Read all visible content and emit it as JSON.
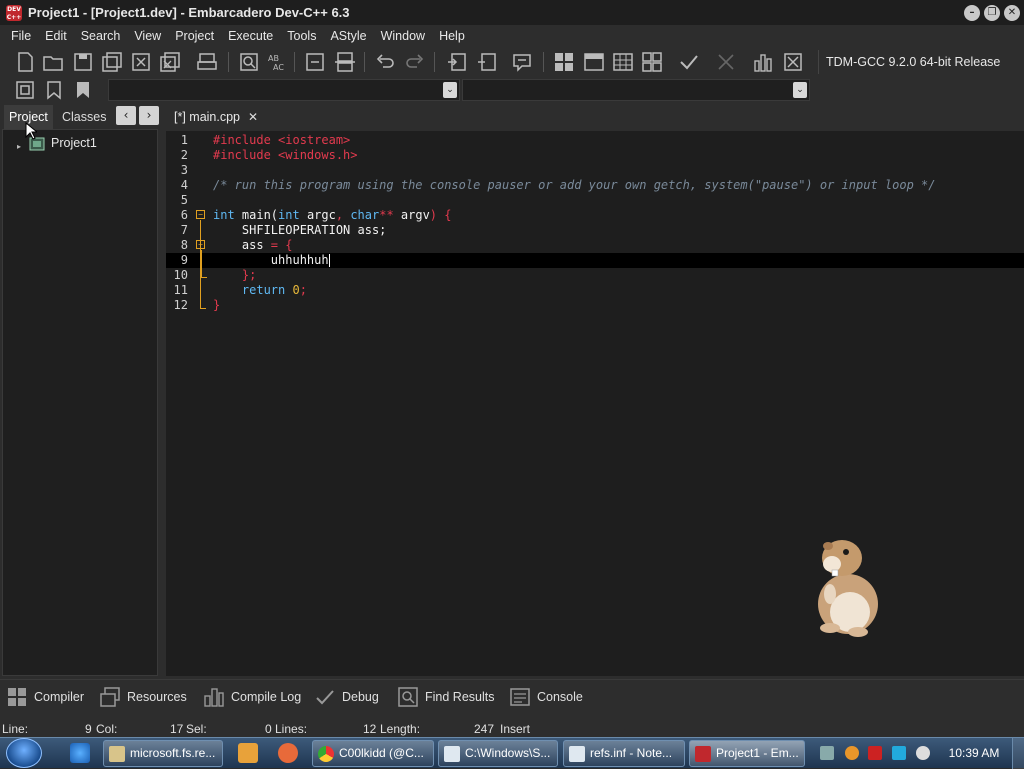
{
  "window": {
    "title": "Project1 - [Project1.dev] - Embarcadero Dev-C++ 6.3",
    "logo_text": "DEV C++",
    "controls": [
      "minimize",
      "restore",
      "close"
    ]
  },
  "menu": [
    "File",
    "Edit",
    "Search",
    "View",
    "Project",
    "Execute",
    "Tools",
    "AStyle",
    "Window",
    "Help"
  ],
  "toolbar": {
    "compiler": "TDM-GCC 9.2.0 64-bit Release",
    "buttons": [
      "new-icon",
      "open-icon",
      "save-icon",
      "save-all-icon",
      "close-icon",
      "close-all-icon",
      "print-icon",
      "find-icon",
      "replace-icon",
      "goto-icon",
      "layout-icon",
      "undo-icon",
      "redo-icon",
      "indent-icon",
      "unindent-icon",
      "comment-icon",
      "compile-icon",
      "run-icon",
      "compile-run-icon",
      "rebuild-icon",
      "syntax-check-icon",
      "stop-icon",
      "chart-icon",
      "debug-stop-icon"
    ]
  },
  "left_panel": {
    "tabs": [
      "Project",
      "Classes"
    ],
    "active_tab": "Project",
    "tree": [
      {
        "label": "Project1"
      }
    ]
  },
  "editor": {
    "tab_label": "[*] main.cpp",
    "current_line": 9,
    "lines": [
      {
        "n": "1"
      },
      {
        "n": "2"
      },
      {
        "n": "3"
      },
      {
        "n": "4"
      },
      {
        "n": "5"
      },
      {
        "n": "6"
      },
      {
        "n": "7"
      },
      {
        "n": "8"
      },
      {
        "n": "9"
      },
      {
        "n": "10"
      },
      {
        "n": "11"
      },
      {
        "n": "12"
      }
    ],
    "code": {
      "l1": "#include <iostream>",
      "l2": "#include <windows.h>",
      "l4": "/* run this program using the console pauser or add your own getch, system(\"pause\") or input loop */",
      "l6_kw": "int",
      "l6_fn": " main(",
      "l6_kw2": "int",
      "l6_a": " argc",
      "l6_c": ",",
      "l6_kw3": " char",
      "l6_st": "**",
      "l6_b": " argv",
      "l6_end": ") {",
      "l7": "    SHFILEOPERATION ass;",
      "l8_a": "    ass ",
      "l8_b": "= {",
      "l9": "        uhhuhhuh",
      "l10": "    };",
      "l11_kw": "    return ",
      "l11_num": "0",
      "l11_end": ";",
      "l12": "}"
    }
  },
  "bottom_tabs": [
    {
      "label": "Compiler",
      "icon": "compiler-grid-icon"
    },
    {
      "label": "Resources",
      "icon": "resources-icon"
    },
    {
      "label": "Compile Log",
      "icon": "compile-log-chart-icon"
    },
    {
      "label": "Debug",
      "icon": "debug-check-icon"
    },
    {
      "label": "Find Results",
      "icon": "find-results-icon"
    },
    {
      "label": "Console",
      "icon": "console-icon"
    }
  ],
  "status": {
    "line_label": "Line:",
    "line_val": "9",
    "col_label": "Col:",
    "col_val": "17",
    "sel_label": "Sel:",
    "sel_val": "0",
    "lines_label": "Lines:",
    "lines_val": "12",
    "length_label": "Length:",
    "length_val": "247",
    "mode": "Insert"
  },
  "taskbar": {
    "tasks": [
      {
        "label": "microsoft.fs.re...",
        "icon": "explorer-icon"
      },
      {
        "label": "C00lkidd (@C...",
        "icon": "chrome-icon"
      },
      {
        "label": "C:\\Windows\\S...",
        "icon": "notepad-icon"
      },
      {
        "label": "refs.inf - Note...",
        "icon": "notepad-icon"
      },
      {
        "label": "Project1 - Em...",
        "icon": "devcpp-icon"
      }
    ],
    "clock": "10:39 AM"
  },
  "colors": {
    "accent": "#e23a4e",
    "keyword": "#5fb8f2",
    "number": "#e8b93a",
    "comment": "#7a8a9a",
    "fold": "#e0a020"
  }
}
